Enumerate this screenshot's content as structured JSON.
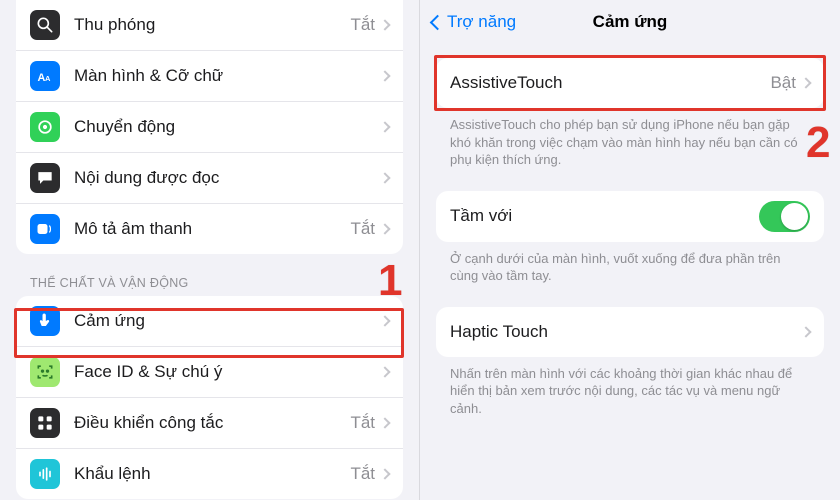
{
  "left": {
    "off_label": "Tắt",
    "section_physical": "THỂ CHẤT VÀ VẬN ĐỘNG",
    "rows_top": [
      {
        "label": "Thu phóng",
        "value": "Tắt"
      },
      {
        "label": "Màn hình & Cỡ chữ",
        "value": ""
      },
      {
        "label": "Chuyển động",
        "value": ""
      },
      {
        "label": "Nội dung được đọc",
        "value": ""
      },
      {
        "label": "Mô tả âm thanh",
        "value": "Tắt"
      }
    ],
    "rows_bottom": [
      {
        "label": "Cảm ứng",
        "value": ""
      },
      {
        "label": "Face ID & Sự chú ý",
        "value": ""
      },
      {
        "label": "Điều khiển công tắc",
        "value": "Tắt"
      },
      {
        "label": "Khẩu lệnh",
        "value": "Tắt"
      }
    ]
  },
  "right": {
    "back_label": "Trợ năng",
    "title": "Cảm ứng",
    "assistive": {
      "label": "AssistiveTouch",
      "value": "Bật"
    },
    "assistive_note": "AssistiveTouch cho phép bạn sử dụng iPhone nếu bạn gặp khó khăn trong việc chạm vào màn hình hay nếu bạn cần có phụ kiện thích ứng.",
    "reach": {
      "label": "Tầm với",
      "on": true
    },
    "reach_note": "Ở cạnh dưới của màn hình, vuốt xuống để đưa phần trên cùng vào tầm tay.",
    "haptic": {
      "label": "Haptic Touch"
    },
    "haptic_note": "Nhấn trên màn hình với các khoảng thời gian khác nhau để hiển thị bản xem trước nội dung, các tác vụ và menu ngữ cảnh."
  },
  "annotations": {
    "one": "1",
    "two": "2"
  }
}
